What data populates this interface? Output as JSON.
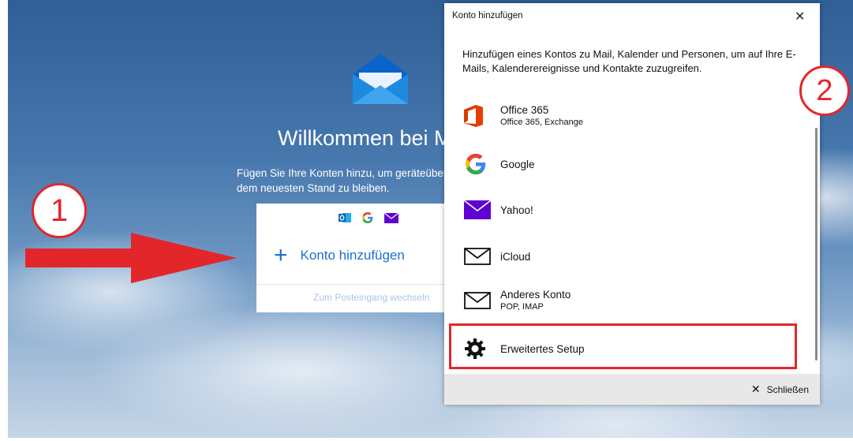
{
  "welcome": {
    "title": "Willkommen bei M",
    "description_line1": "Fügen Sie Ihre Konten hinzu, um geräteübergreifend auf",
    "description_line2": "dem neuesten Stand zu bleiben.",
    "add_account_label": "Konto hinzufügen",
    "inbox_link": "Zum Posteingang wechseln"
  },
  "callouts": {
    "one": "1",
    "two": "2"
  },
  "dialog": {
    "title": "Konto hinzufügen",
    "intro": "Hinzufügen eines Kontos zu Mail, Kalender und Personen, um auf Ihre E-Mails, Kalenderereignisse und Kontakte zuzugreifen.",
    "accounts": [
      {
        "name": "Office 365",
        "sub": "Office 365, Exchange",
        "icon": "office-icon"
      },
      {
        "name": "Google",
        "sub": "",
        "icon": "google-icon"
      },
      {
        "name": "Yahoo!",
        "sub": "",
        "icon": "yahoo-icon"
      },
      {
        "name": "iCloud",
        "sub": "",
        "icon": "envelope-icon"
      },
      {
        "name": "Anderes Konto",
        "sub": "POP, IMAP",
        "icon": "envelope-icon"
      },
      {
        "name": "Erweitertes Setup",
        "sub": "",
        "icon": "gear-icon"
      }
    ],
    "close_label": "Schließen"
  },
  "colors": {
    "accent": "#1b6fd0",
    "annotation_red": "#e3262a",
    "yahoo_purple": "#5f01d1"
  }
}
